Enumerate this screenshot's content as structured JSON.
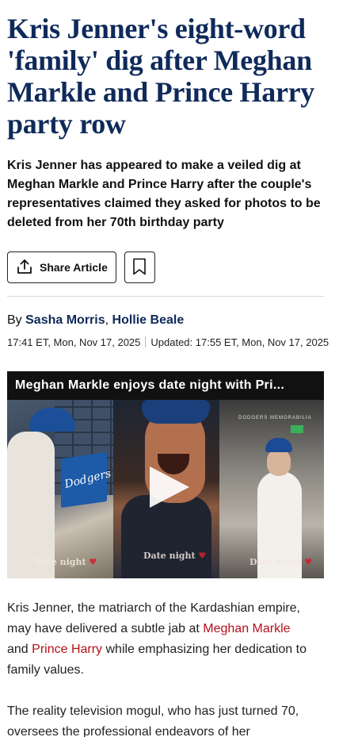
{
  "article": {
    "headline": "Kris Jenner's eight-word 'family' dig after Meghan Markle and Prince Harry party row",
    "standfirst": "Kris Jenner has appeared to make a veiled dig at Meghan Markle and Prince Harry after the couple's representatives claimed they asked for photos to be deleted from her 70th birthday party"
  },
  "actions": {
    "share_label": "Share Article",
    "share_icon": "share-upload-icon",
    "bookmark_icon": "bookmark-icon"
  },
  "byline": {
    "prefix": "By",
    "authors": [
      "Sasha Morris",
      "Hollie Beale"
    ],
    "separator": ","
  },
  "dates": {
    "published": "17:41 ET, Mon, Nov 17, 2025",
    "updated": "Updated: 17:55 ET, Mon, Nov 17, 2025"
  },
  "video": {
    "title": "Meghan Markle enjoys date night with Pri...",
    "captions": [
      "Date night",
      "Date night",
      "Date night"
    ],
    "heart": "♥",
    "sign_text": "Dodgers",
    "wall_text": "DODGERS MEMORABILIA"
  },
  "body": {
    "p1_before": "Kris Jenner, the matriarch of the Kardashian empire, may have delivered a subtle jab at ",
    "p1_link1": "Meghan Markle",
    "p1_mid": " and ",
    "p1_link2": "Prince Harry",
    "p1_after": " while emphasizing her dedication to family values.",
    "p2": "The reality television mogul, who has just turned 70, oversees the professional endeavors of her"
  },
  "colors": {
    "headline": "#0f2a5a",
    "link": "#b3101a",
    "author": "#0f2a5a"
  }
}
